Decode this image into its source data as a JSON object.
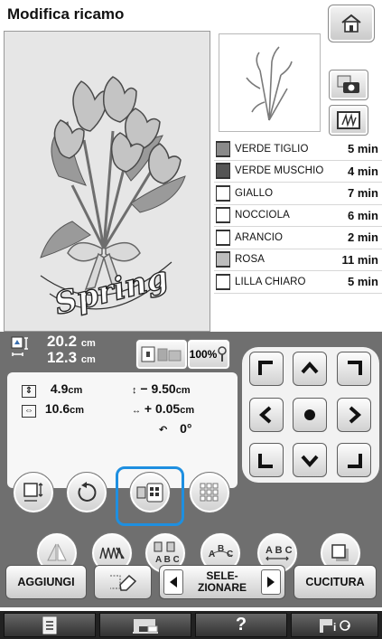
{
  "header": {
    "title": "Modifica ricamo"
  },
  "icons": {
    "home": "home-icon",
    "camera": "camera-scan-icon",
    "frame": "frame-stitch-icon"
  },
  "embroidery": {
    "text": "Spring"
  },
  "thread_colors": [
    {
      "name": "VERDE TIGLIO",
      "time": "5 min",
      "color": "#8a8a8a"
    },
    {
      "name": "VERDE MUSCHIO",
      "time": "4 min",
      "color": "#555555"
    },
    {
      "name": "GIALLO",
      "time": "7 min",
      "color": "#ffffff"
    },
    {
      "name": "NOCCIOLA",
      "time": "6 min",
      "color": "#ffffff"
    },
    {
      "name": "ARANCIO",
      "time": "2 min",
      "color": "#ffffff"
    },
    {
      "name": "ROSA",
      "time": "11 min",
      "color": "#bdbdbd"
    },
    {
      "name": "LILLA CHIARO",
      "time": "5 min",
      "color": "#ffffff"
    }
  ],
  "size": {
    "width": "20.2",
    "height": "12.3",
    "unit": "cm"
  },
  "zoom": "100%",
  "position": {
    "height": "4.9",
    "height_unit": "cm",
    "width": "10.6",
    "width_unit": "cm",
    "vertical_offset": "− 9.50",
    "vertical_unit": "cm",
    "horizontal_offset": "+ 0.05",
    "horizontal_unit": "cm",
    "rotation": "0°"
  },
  "buttons": {
    "add": "AGGIUNGI",
    "select_line1": "SELE-",
    "select_line2": "ZIONARE",
    "sew": "CUCITURA",
    "help": "?"
  },
  "accent_color": "#1e8fe0"
}
